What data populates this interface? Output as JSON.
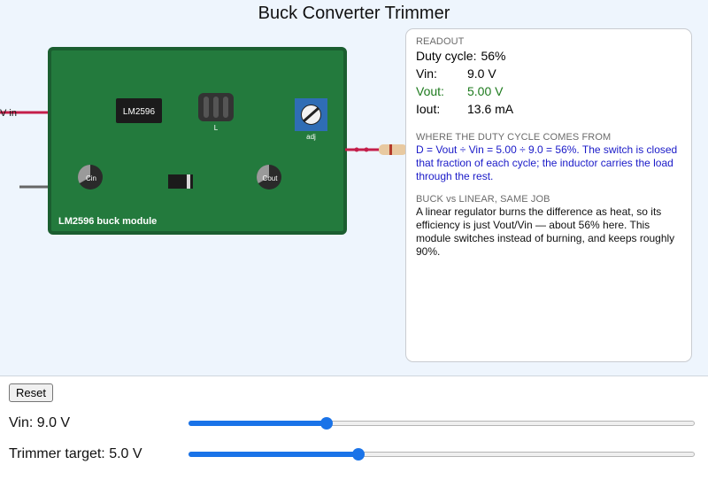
{
  "app": {
    "title": "Buck Converter Trimmer"
  },
  "board": {
    "module_label": "LM2596 buck module",
    "ic_label": "LM2596",
    "inductor_label": "L",
    "trimmer_label": "adj",
    "cin_label": "Cin",
    "cout_label": "Cout",
    "vin_wire_label": "V in"
  },
  "readout": {
    "heading": "READOUT",
    "duty_label": "Duty cycle:",
    "duty_value": "56%",
    "vin_label": "Vin:",
    "vin_value": "9.0 V",
    "vout_label": "Vout:",
    "vout_value": "5.00 V",
    "iout_label": "Iout:",
    "iout_value": "13.6 mA",
    "duty_heading": "WHERE THE DUTY CYCLE COMES FROM",
    "duty_text": "D = Vout ÷ Vin = 5.00 ÷ 9.0 = 56%. The switch is closed that fraction of each cycle; the inductor carries the load through the rest.",
    "linear_heading": "BUCK vs LINEAR, SAME JOB",
    "linear_text": "A linear regulator burns the difference as heat, so its efficiency is just Vout/Vin — about 56% here. This module switches instead of burning, and keeps roughly 90%."
  },
  "controls": {
    "reset_label": "Reset",
    "vin_slider": {
      "label": "Vin: 9.0 V",
      "fraction": 0.273
    },
    "trim_slider": {
      "label": "Trimmer target: 5.0 V",
      "fraction": 0.336
    }
  },
  "colors": {
    "pcb": "#237a3d",
    "pcb_border": "#1b5e30",
    "wire_positive": "#c41e4a",
    "wire_ground": "#666666",
    "trimmer": "#2f6db5",
    "accent": "#1a73e8",
    "vout_text": "#1d7a1d",
    "explain_text": "#1a1ac8"
  }
}
